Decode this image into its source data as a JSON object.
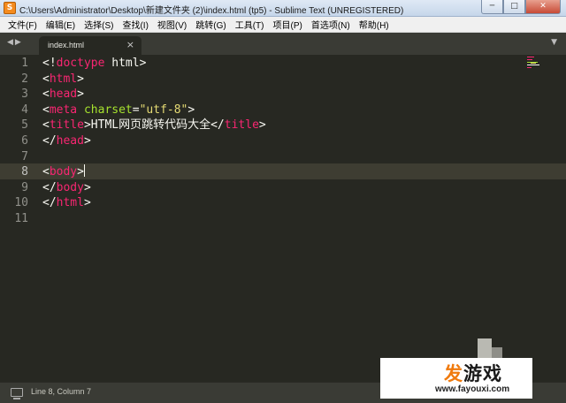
{
  "window": {
    "title": "C:\\Users\\Administrator\\Desktop\\新建文件夹 (2)\\index.html (tp5) - Sublime Text (UNREGISTERED)",
    "icon_glyph": "S",
    "minimize_glyph": "─",
    "maximize_glyph": "□",
    "close_glyph": "✕"
  },
  "menu": [
    "文件(F)",
    "编辑(E)",
    "选择(S)",
    "查找(I)",
    "视图(V)",
    "跳转(G)",
    "工具(T)",
    "项目(P)",
    "首选项(N)",
    "帮助(H)"
  ],
  "tabs": {
    "nav_glyph": "◀▶",
    "scroll_glyph": "▼",
    "active": {
      "label": "index.html",
      "close_glyph": "×"
    }
  },
  "editor": {
    "line_numbers": [
      "1",
      "2",
      "3",
      "4",
      "5",
      "6",
      "7",
      "8",
      "9",
      "10",
      "11"
    ],
    "current_line": 8,
    "lines": [
      [
        [
          "t-punct",
          "<!"
        ],
        [
          "t-kw",
          "doctype"
        ],
        [
          "t-text",
          " html"
        ],
        [
          "t-punct",
          ">"
        ]
      ],
      [
        [
          "t-punct",
          "<"
        ],
        [
          "t-tag",
          "html"
        ],
        [
          "t-punct",
          ">"
        ]
      ],
      [
        [
          "t-punct",
          "<"
        ],
        [
          "t-tag",
          "head"
        ],
        [
          "t-punct",
          ">"
        ]
      ],
      [
        [
          "t-punct",
          "<"
        ],
        [
          "t-tag",
          "meta"
        ],
        [
          "t-text",
          " "
        ],
        [
          "t-attr",
          "charset"
        ],
        [
          "t-punct",
          "="
        ],
        [
          "t-str",
          "\"utf-8\""
        ],
        [
          "t-punct",
          ">"
        ]
      ],
      [
        [
          "t-punct",
          "<"
        ],
        [
          "t-tag",
          "title"
        ],
        [
          "t-punct",
          ">"
        ],
        [
          "t-text",
          "HTML网页跳转代码大全"
        ],
        [
          "t-punct",
          "</"
        ],
        [
          "t-tag",
          "title"
        ],
        [
          "t-punct",
          ">"
        ]
      ],
      [
        [
          "t-punct",
          "</"
        ],
        [
          "t-tag",
          "head"
        ],
        [
          "t-punct",
          ">"
        ]
      ],
      [],
      [
        [
          "t-punct",
          "<"
        ],
        [
          "t-tag",
          "body"
        ],
        [
          "t-punct",
          ">"
        ]
      ],
      [
        [
          "t-punct",
          "</"
        ],
        [
          "t-tag",
          "body"
        ],
        [
          "t-punct",
          ">"
        ]
      ],
      [
        [
          "t-punct",
          "</"
        ],
        [
          "t-tag",
          "html"
        ],
        [
          "t-punct",
          ">"
        ]
      ],
      []
    ]
  },
  "status": {
    "position": "Line 8, Column 7"
  },
  "watermark": {
    "logo_a": "发",
    "logo_b": "游戏",
    "url": "www.fayouxi.com"
  },
  "colors": {
    "background": "#272822",
    "tag": "#f92672",
    "attribute": "#a6e22e",
    "string": "#e6db74",
    "text": "#f8f8f2",
    "watermark_orange": "#f07a0d"
  }
}
